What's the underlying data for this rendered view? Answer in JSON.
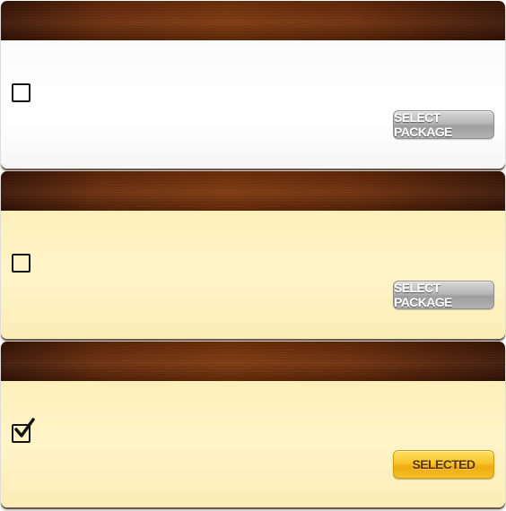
{
  "packages": [
    {
      "checked": false,
      "button_label": "SELECT PACKAGE",
      "theme": {
        "header": "#6a2a07",
        "body": "#ffffff"
      }
    },
    {
      "checked": false,
      "button_label": "SELECT PACKAGE",
      "theme": {
        "header": "#6a2a07",
        "body": "#fef4c7"
      }
    },
    {
      "checked": true,
      "button_label": "SELECTED",
      "theme": {
        "header": "#6a2a07",
        "body": "#fef4c7"
      }
    }
  ],
  "icons": {
    "checkbox_empty": "checkbox-empty-icon",
    "checkbox_checked": "checkbox-checked-icon"
  },
  "colors": {
    "button_default": "#b3b3b3",
    "button_selected": "#f8c52a",
    "checkbox_border": "#151515"
  }
}
